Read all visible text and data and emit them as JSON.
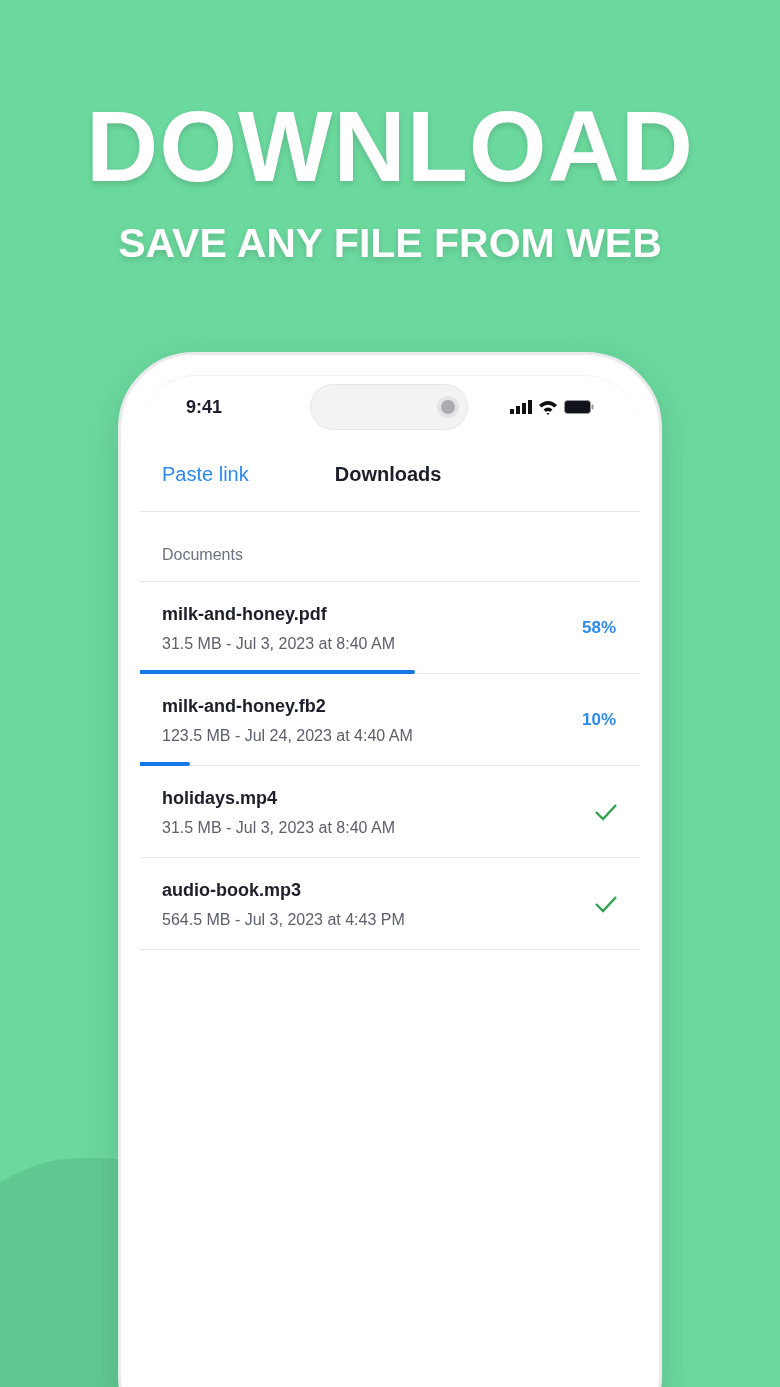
{
  "headline": "DOWNLOAD",
  "subheadline": "SAVE ANY FILE FROM WEB",
  "status_bar": {
    "time": "9:41"
  },
  "nav": {
    "left_action": "Paste link",
    "title": "Downloads"
  },
  "section": "Documents",
  "files": [
    {
      "kind": "progress",
      "name": "milk-and-honey.pdf",
      "details": "31.5 MB - Jul 3, 2023 at 8:40 AM",
      "percent": "58%",
      "level": 0.55
    },
    {
      "kind": "progress",
      "name": "milk-and-honey.fb2",
      "details": "123.5 MB - Jul 24, 2023 at 4:40 AM",
      "percent": "10%",
      "level": 0.1
    },
    {
      "kind": "done",
      "name": "holidays.mp4",
      "details": "31.5 MB - Jul 3, 2023 at 8:40 AM"
    },
    {
      "kind": "done",
      "name": "audio-book.mp3",
      "details": "564.5 MB - Jul 3, 2023 at 4:43 PM"
    }
  ]
}
